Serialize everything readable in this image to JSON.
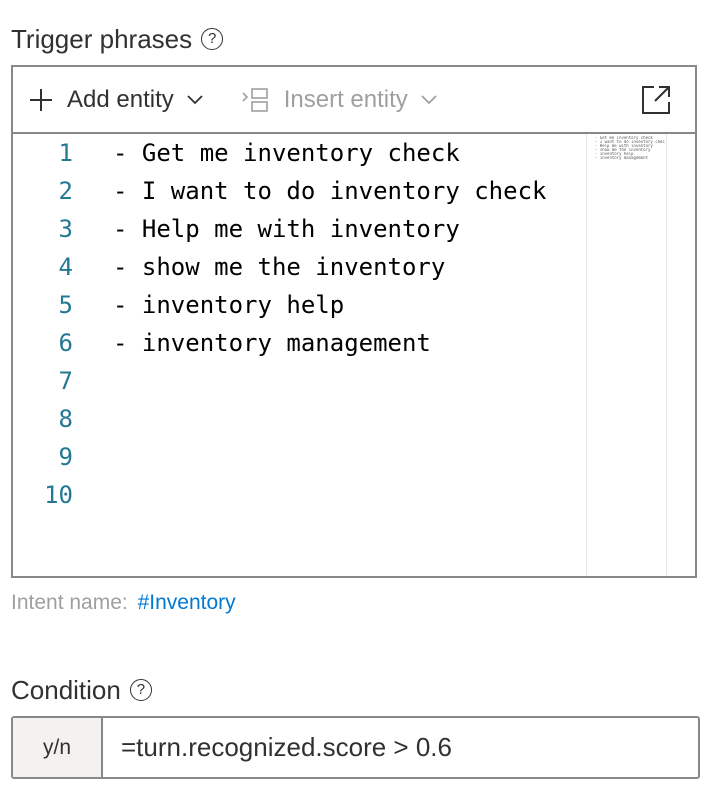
{
  "trigger": {
    "label": "Trigger phrases",
    "help_icon": "?"
  },
  "toolbar": {
    "add_entity": "Add entity",
    "insert_entity": "Insert entity"
  },
  "editor": {
    "line_numbers": [
      "1",
      "2",
      "3",
      "4",
      "5",
      "6",
      "7",
      "8",
      "9",
      "10"
    ],
    "lines": [
      "- Get me inventory check",
      "- I want to do inventory check",
      "- Help me with inventory",
      "- show me the inventory",
      "- inventory help",
      "- inventory management",
      "",
      "",
      "",
      ""
    ]
  },
  "intent": {
    "label": "Intent name:",
    "value": "#Inventory"
  },
  "condition": {
    "label": "Condition",
    "help_icon": "?",
    "prefix": "y/n",
    "value": "=turn.recognized.score > 0.6"
  },
  "colors": {
    "accent": "#0078d4",
    "line_number": "#237893",
    "border": "#8a8886",
    "disabled_text": "#a19f9d"
  }
}
